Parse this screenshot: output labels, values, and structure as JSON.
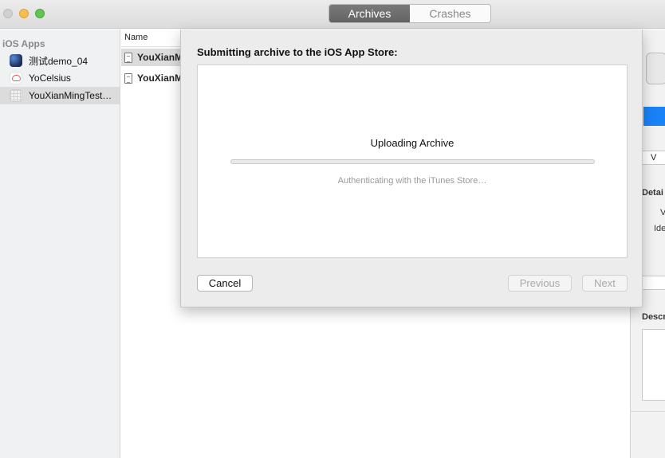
{
  "window": {
    "tabs": [
      {
        "label": "Archives",
        "active": true
      },
      {
        "label": "Crashes",
        "active": false
      }
    ]
  },
  "sidebar": {
    "header": "iOS Apps",
    "items": [
      {
        "label": "测试demo_04",
        "icon": "app-icon-demo"
      },
      {
        "label": "YoCelsius",
        "icon": "app-icon-yocelsius"
      },
      {
        "label": "YouXianMingTest…",
        "icon": "app-icon-youxianming",
        "selected": true
      }
    ]
  },
  "list": {
    "column_name": "Name",
    "rows": [
      {
        "name": "YouXianM",
        "selected": true
      },
      {
        "name": "YouXianM",
        "selected": false
      }
    ]
  },
  "details": {
    "input_value": "V",
    "section_details": "Detai",
    "label_version": "V",
    "label_identifier": "Ide",
    "section_description": "Descr"
  },
  "sheet": {
    "title": "Submitting archive to the iOS App Store:",
    "upload_title": "Uploading Archive",
    "status": "Authenticating with the iTunes Store…",
    "progress": 0,
    "buttons": {
      "cancel": "Cancel",
      "previous": "Previous",
      "next": "Next"
    }
  },
  "colors": {
    "accent": "#1a82f7",
    "tab_active": "#6b6b6b",
    "traffic_minimize": "#f5bf4f",
    "traffic_maximize": "#61c454"
  }
}
